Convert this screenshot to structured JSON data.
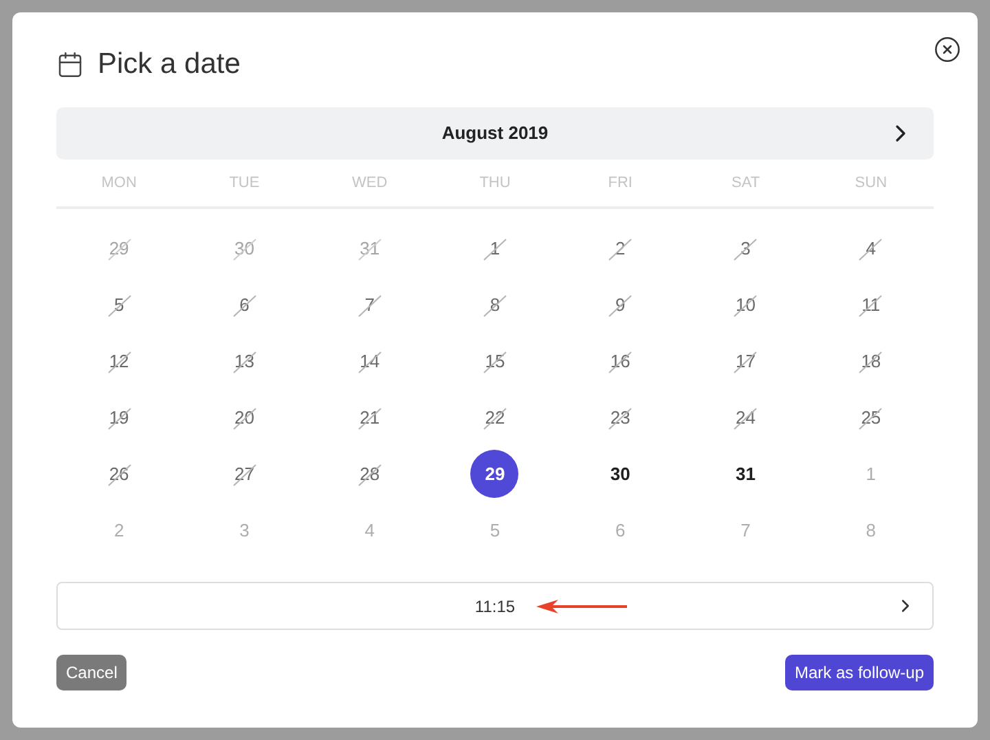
{
  "dialog": {
    "title": "Pick a date"
  },
  "calendar": {
    "month": "August 2019",
    "weekdays": [
      "MON",
      "TUE",
      "WED",
      "THU",
      "FRI",
      "SAT",
      "SUN"
    ],
    "days": [
      {
        "label": "29",
        "kind": "past_outside",
        "selected": false
      },
      {
        "label": "30",
        "kind": "past_outside",
        "selected": false
      },
      {
        "label": "31",
        "kind": "past_outside",
        "selected": false
      },
      {
        "label": "1",
        "kind": "past",
        "selected": false
      },
      {
        "label": "2",
        "kind": "past",
        "selected": false
      },
      {
        "label": "3",
        "kind": "past",
        "selected": false
      },
      {
        "label": "4",
        "kind": "past",
        "selected": false
      },
      {
        "label": "5",
        "kind": "past",
        "selected": false
      },
      {
        "label": "6",
        "kind": "past",
        "selected": false
      },
      {
        "label": "7",
        "kind": "past",
        "selected": false
      },
      {
        "label": "8",
        "kind": "past",
        "selected": false
      },
      {
        "label": "9",
        "kind": "past",
        "selected": false
      },
      {
        "label": "10",
        "kind": "past",
        "selected": false
      },
      {
        "label": "11",
        "kind": "past",
        "selected": false
      },
      {
        "label": "12",
        "kind": "past",
        "selected": false
      },
      {
        "label": "13",
        "kind": "past",
        "selected": false
      },
      {
        "label": "14",
        "kind": "past",
        "selected": false
      },
      {
        "label": "15",
        "kind": "past",
        "selected": false
      },
      {
        "label": "16",
        "kind": "past",
        "selected": false
      },
      {
        "label": "17",
        "kind": "past",
        "selected": false
      },
      {
        "label": "18",
        "kind": "past",
        "selected": false
      },
      {
        "label": "19",
        "kind": "past",
        "selected": false
      },
      {
        "label": "20",
        "kind": "past",
        "selected": false
      },
      {
        "label": "21",
        "kind": "past",
        "selected": false
      },
      {
        "label": "22",
        "kind": "past",
        "selected": false
      },
      {
        "label": "23",
        "kind": "past",
        "selected": false
      },
      {
        "label": "24",
        "kind": "past",
        "selected": false
      },
      {
        "label": "25",
        "kind": "past",
        "selected": false
      },
      {
        "label": "26",
        "kind": "past",
        "selected": false
      },
      {
        "label": "27",
        "kind": "past",
        "selected": false
      },
      {
        "label": "28",
        "kind": "past",
        "selected": false
      },
      {
        "label": "29",
        "kind": "available",
        "selected": true
      },
      {
        "label": "30",
        "kind": "available",
        "selected": false
      },
      {
        "label": "31",
        "kind": "available",
        "selected": false
      },
      {
        "label": "1",
        "kind": "outside",
        "selected": false
      },
      {
        "label": "2",
        "kind": "outside",
        "selected": false
      },
      {
        "label": "3",
        "kind": "outside",
        "selected": false
      },
      {
        "label": "4",
        "kind": "outside",
        "selected": false
      },
      {
        "label": "5",
        "kind": "outside",
        "selected": false
      },
      {
        "label": "6",
        "kind": "outside",
        "selected": false
      },
      {
        "label": "7",
        "kind": "outside",
        "selected": false
      },
      {
        "label": "8",
        "kind": "outside",
        "selected": false
      }
    ]
  },
  "time": {
    "value": "11:15"
  },
  "buttons": {
    "cancel": "Cancel",
    "confirm": "Mark as follow-up"
  }
}
